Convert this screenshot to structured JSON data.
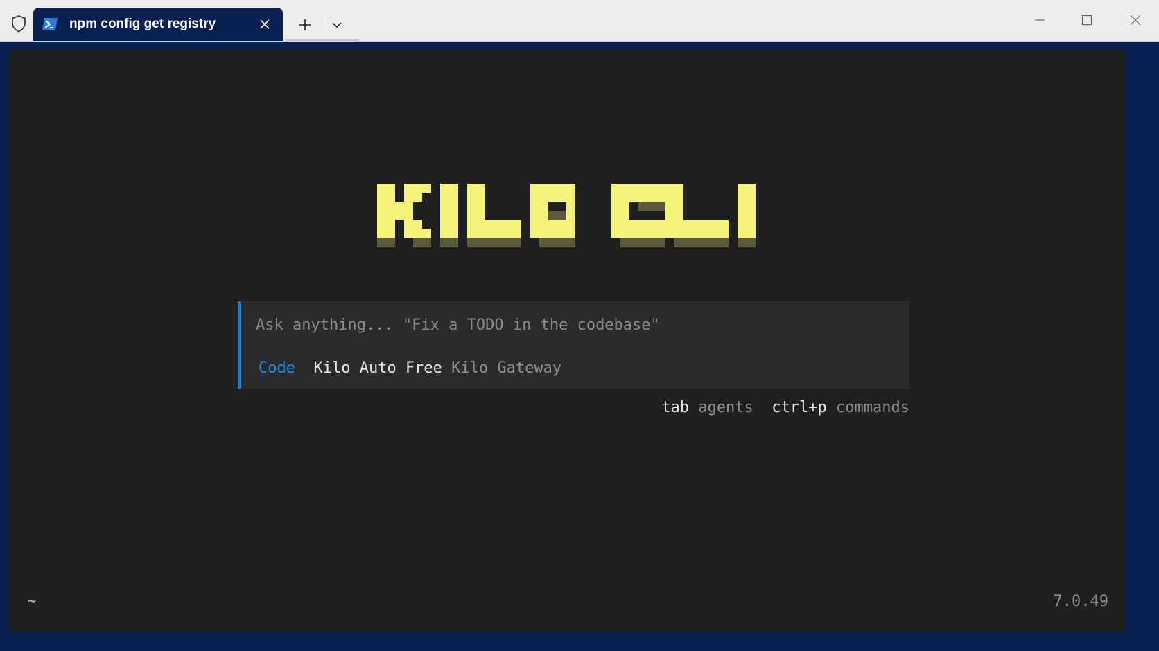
{
  "window": {
    "tab_title": "npm config get registry",
    "icons": {
      "shield": "shield-icon",
      "tab": "powershell-icon",
      "close_tab": "close-icon",
      "new_tab": "plus-icon",
      "dropdown": "chevron-down-icon",
      "minimize": "minimize-icon",
      "maximize": "maximize-icon",
      "close_window": "close-icon"
    }
  },
  "terminal": {
    "logo_text": "KILO CLI",
    "prompt": {
      "placeholder": "Ask anything... \"Fix a TODO in the codebase\"",
      "value": ""
    },
    "status": {
      "agent": "Code",
      "model": "Kilo Auto Free",
      "provider": "Kilo Gateway"
    },
    "hints": [
      {
        "key": "tab",
        "label": "agents"
      },
      {
        "key": "ctrl+p",
        "label": "commands"
      }
    ],
    "cwd": "~",
    "version": "7.0.49"
  },
  "colors": {
    "window_frame": "#0a2050",
    "terminal_bg": "#202020",
    "logo_yellow": "#f5f27a",
    "logo_shadow": "#5c5a3c",
    "accent_blue": "#1f8ee8"
  }
}
